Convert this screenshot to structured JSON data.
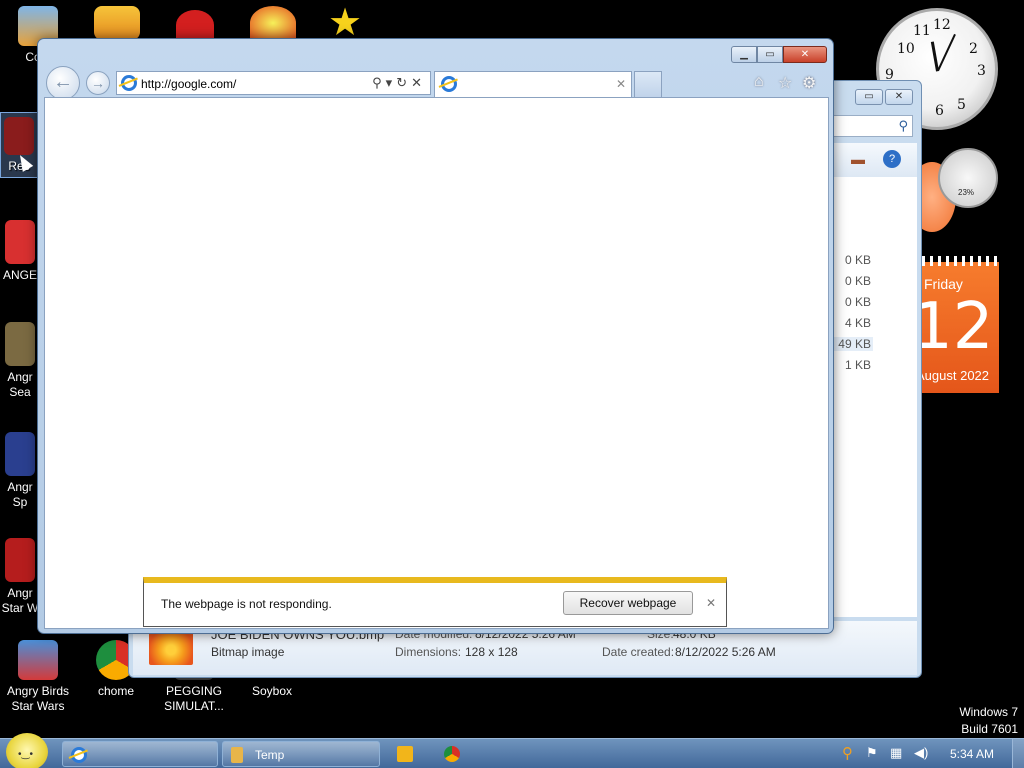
{
  "desktop": {
    "icons": [
      {
        "label": "Com",
        "color": "#e8a23a"
      },
      {
        "label": "Rec",
        "color": "#8a1c1c"
      },
      {
        "label": "ANGE",
        "color": "#d83030"
      },
      {
        "label": "Angr\nSea",
        "color": "#7b6a42"
      },
      {
        "label": "Angr\nSp",
        "color": "#2a3f8f"
      },
      {
        "label": "Angr\nStar W",
        "color": "#b51d1d"
      },
      {
        "label": "Angry Birds\nStar Wars",
        "color": "#d43a3a"
      },
      {
        "label": "chome",
        "color": "#2a9d4a"
      },
      {
        "label": "PEGGING\nSIMULAT...",
        "color": "#333333"
      },
      {
        "label": "Soybox",
        "color": "#000000"
      }
    ],
    "build": {
      "line1": "Windows 7",
      "line2": "Build 7601"
    }
  },
  "explorer": {
    "file_sizes": [
      "0 KB",
      "0 KB",
      "0 KB",
      "4 KB",
      "49 KB",
      "1 KB"
    ],
    "details": {
      "filename": "JOE BIDEN OWNS YOU.bmp",
      "type": "Bitmap image",
      "date_modified_label": "Date modified:",
      "date_modified": "8/12/2022 5:26 AM",
      "size_label": "Size:",
      "size": "48.0 KB",
      "dimensions_label": "Dimensions:",
      "dimensions": "128 x 128",
      "date_created_label": "Date created:",
      "date_created": "8/12/2022 5:26 AM"
    }
  },
  "gadgets": {
    "calendar": {
      "day": "Friday",
      "date": "12",
      "month": "August 2022"
    },
    "meter_pct": "23%"
  },
  "browser": {
    "address": "http://google.com/",
    "notification": {
      "message": "The webpage is not responding.",
      "button": "Recover webpage"
    }
  },
  "taskbar": {
    "items": [
      {
        "label": ""
      },
      {
        "label": "Temp"
      }
    ],
    "clock": "5:34 AM"
  },
  "colors": {
    "accent_warning": "#e8b91e",
    "close": "#c9412a",
    "taskbar": "#42689a"
  }
}
